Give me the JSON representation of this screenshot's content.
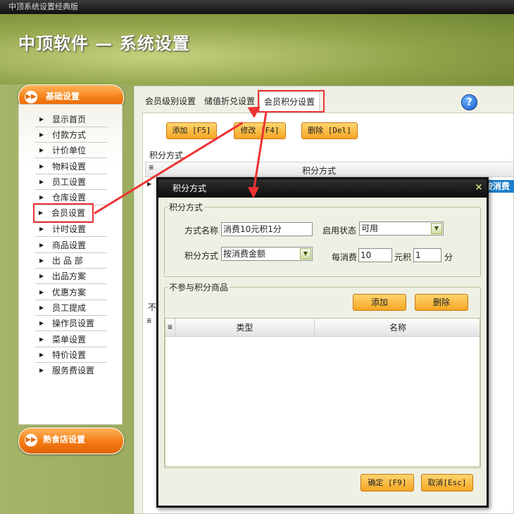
{
  "window": {
    "title": "中顶系统设置经典版"
  },
  "header": {
    "app_title": "中顶软件 — 系统设置"
  },
  "sidebar": {
    "basic_title": "基础设置",
    "deli_title": "熟食店设置",
    "items": [
      {
        "label": "显示首页"
      },
      {
        "label": "付款方式"
      },
      {
        "label": "计价单位"
      },
      {
        "label": "物料设置"
      },
      {
        "label": "员工设置"
      },
      {
        "label": "仓库设置"
      },
      {
        "label": "会员设置"
      },
      {
        "label": "计时设置"
      },
      {
        "label": "商品设置"
      },
      {
        "label": "出 品 部"
      },
      {
        "label": "出品方案"
      },
      {
        "label": "优惠方案"
      },
      {
        "label": "员工提成"
      },
      {
        "label": "操作员设置"
      },
      {
        "label": "菜单设置"
      },
      {
        "label": "特价设置"
      },
      {
        "label": "服务费设置"
      }
    ]
  },
  "tabs": [
    {
      "label": "会员级别设置"
    },
    {
      "label": "储值折兑设置"
    },
    {
      "label": "会员积分设置"
    }
  ],
  "help_icon_text": "?",
  "toolbar": {
    "add_label": "添加 [F5]",
    "edit_label": "修改 [F4]",
    "delete_label": "删除 [Del]"
  },
  "background": {
    "section_label": "积分方式",
    "grid_header": "积分方式",
    "row_partial": "按消费",
    "second_section_partial": "不"
  },
  "dialog": {
    "title": "积分方式",
    "close_icon": "×",
    "group1_title": "积分方式",
    "name_label": "方式名称",
    "name_value": "消费10元积1分",
    "status_label": "启用状态",
    "status_value": "可用",
    "method_label": "积分方式",
    "method_value": "按消费金额",
    "per_label": "每消费",
    "per_value": "10",
    "unit_label": "元积",
    "points_value": "1",
    "points_unit": "分",
    "group2_title": "不参与积分商品",
    "add_button": "添加",
    "delete_button": "删除",
    "col_type": "类型",
    "col_name": "名称",
    "ok_button": "确定 [F9]",
    "cancel_button": "取消[Esc]"
  },
  "colors": {
    "accent_orange": "#f5a623",
    "highlight_red": "#ee3333",
    "selected_cell_blue": "#1f7fc8"
  }
}
